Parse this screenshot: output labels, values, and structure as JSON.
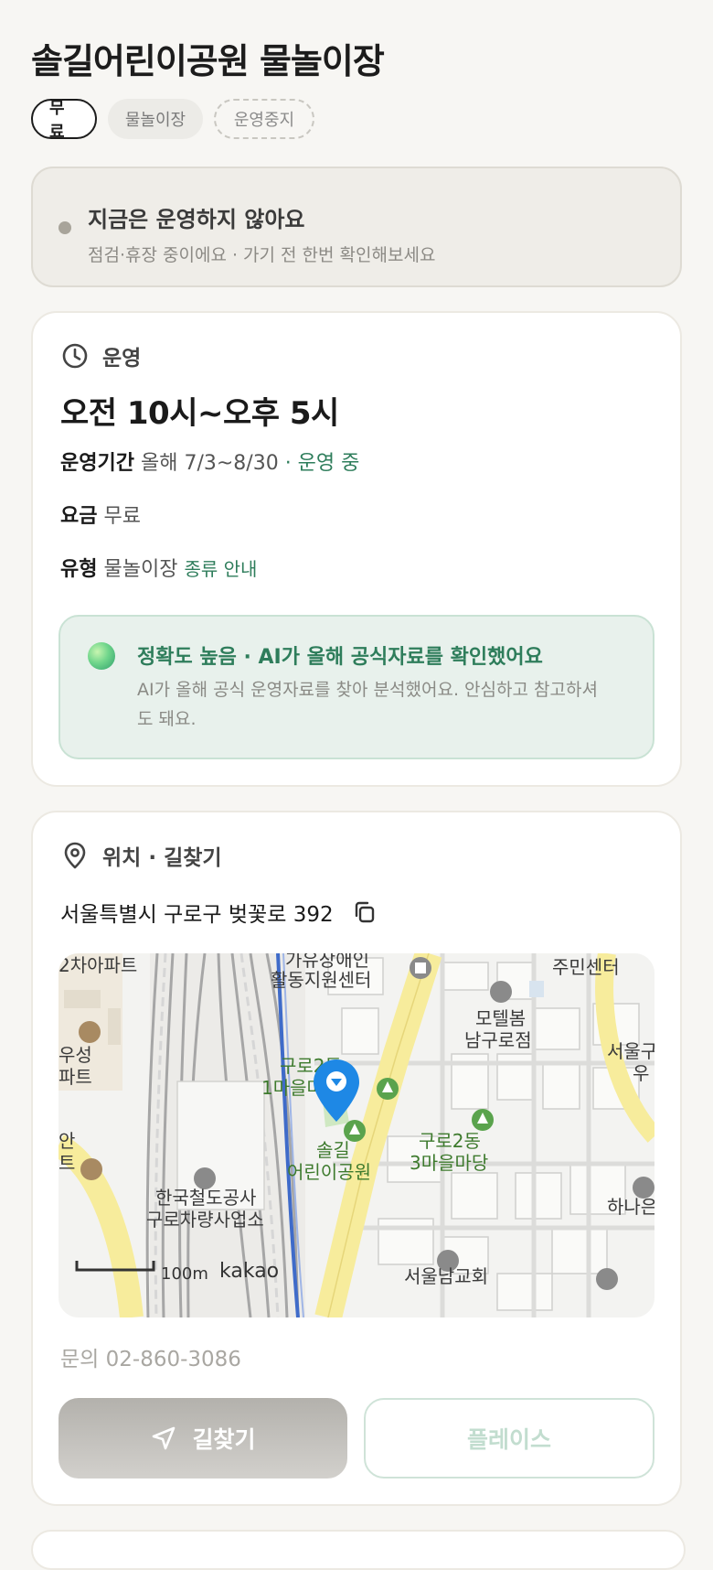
{
  "title": "솔길어린이공원 물놀이장",
  "chips": {
    "fee": "무료",
    "type": "물놀이장",
    "status": "운영중지"
  },
  "status_banner": {
    "title": "지금은 운영하지 않아요",
    "subtitle": "점검·휴장 중이에요 · 가기 전 한번 확인해보세요"
  },
  "hours_card": {
    "section_label": "운영",
    "hours": "오전 10시~오후 5시",
    "period_label": "운영기간",
    "period_value": "올해 7/3~8/30",
    "period_status": "· 운영 중",
    "fee_label": "요금",
    "fee_value": "무료",
    "type_label": "유형",
    "type_value": "물놀이장",
    "type_link": "종류 안내",
    "ai": {
      "title": "정확도 높음 · AI가 올해 공식자료를 확인했어요",
      "body": "AI가 올해 공식 운영자료를 찾아 분석했어요. 안심하고 참고하셔도 돼요."
    }
  },
  "location_card": {
    "section_label": "위치 · 길찾기",
    "address": "서울특별시 구로구 벚꽃로 392",
    "map": {
      "labels": {
        "apt": "2차아파트",
        "center1": "가유장애인",
        "center2": "활동지원센터",
        "community": "주민센터",
        "motel1": "모텔봄",
        "motel2": "남구로점",
        "seoul1": "서울구",
        "seoul2": "우",
        "woosung1": "우성",
        "woosung2": "파트",
        "an1": "안",
        "an2": "트",
        "guro1a": "구로2동",
        "guro1b": "1마을마당",
        "park1": "솔길",
        "park2": "어린이공원",
        "guro2a": "구로2동",
        "guro2b": "3마을마당",
        "hana": "하나은",
        "korail1": "한국철도공사",
        "korail2": "구로차량사업소",
        "church": "서울남교회",
        "scale": "100m",
        "brand": "kakao"
      }
    },
    "phone": "문의 02-860-3086",
    "route_button": "길찾기",
    "place_button": "플레이스"
  },
  "colors": {
    "accent_green": "#2e7d5b",
    "road_yellow": "#f7ec9c",
    "marker_blue": "#1e88e5"
  }
}
